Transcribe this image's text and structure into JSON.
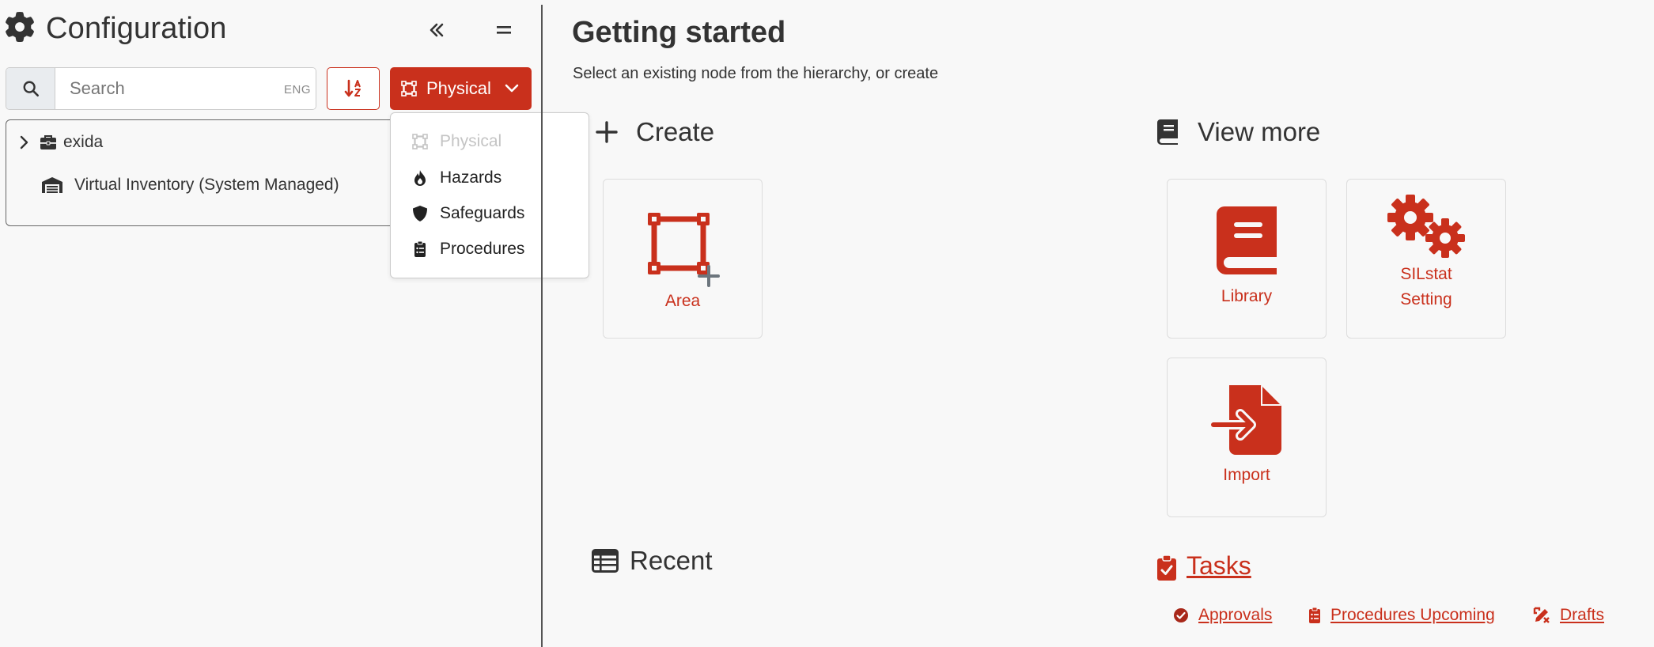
{
  "sidebar": {
    "title": "Configuration",
    "search": {
      "placeholder": "Search",
      "lang": "ENG"
    },
    "view_button_label": "Physical",
    "tree": [
      {
        "label": "exida",
        "icon": "briefcase-icon",
        "expandable": true
      },
      {
        "label": "Virtual Inventory (System Managed)",
        "icon": "warehouse-icon",
        "expandable": false
      }
    ],
    "view_menu": [
      {
        "label": "Physical",
        "icon": "vector-square-icon",
        "disabled": true
      },
      {
        "label": "Hazards",
        "icon": "fire-icon",
        "disabled": false
      },
      {
        "label": "Safeguards",
        "icon": "shield-icon",
        "disabled": false
      },
      {
        "label": "Procedures",
        "icon": "clipboard-list-icon",
        "disabled": false
      }
    ]
  },
  "main": {
    "title": "Getting started",
    "subtitle": "Select an existing node from the hierarchy, or create",
    "create": {
      "heading": "Create",
      "cards": [
        {
          "label": "Area",
          "icon": "area-add-icon"
        }
      ]
    },
    "view_more": {
      "heading": "View more",
      "cards": [
        {
          "label": "Library",
          "icon": "book-icon"
        },
        {
          "label_line1": "SILstat",
          "label_line2": "Setting",
          "icon": "gears-icon"
        },
        {
          "label": "Import",
          "icon": "file-import-icon"
        }
      ]
    },
    "recent": {
      "heading": "Recent"
    },
    "tasks": {
      "heading": "Tasks",
      "links": [
        {
          "label": "Approvals",
          "icon": "circle-check-icon"
        },
        {
          "label": "Procedures Upcoming",
          "icon": "clipboard-list-icon"
        },
        {
          "label": "Drafts",
          "icon": "pen-ruler-icon"
        }
      ]
    }
  },
  "colors": {
    "accent": "#c9301c",
    "text": "#333333",
    "background": "#f8f8f8"
  }
}
